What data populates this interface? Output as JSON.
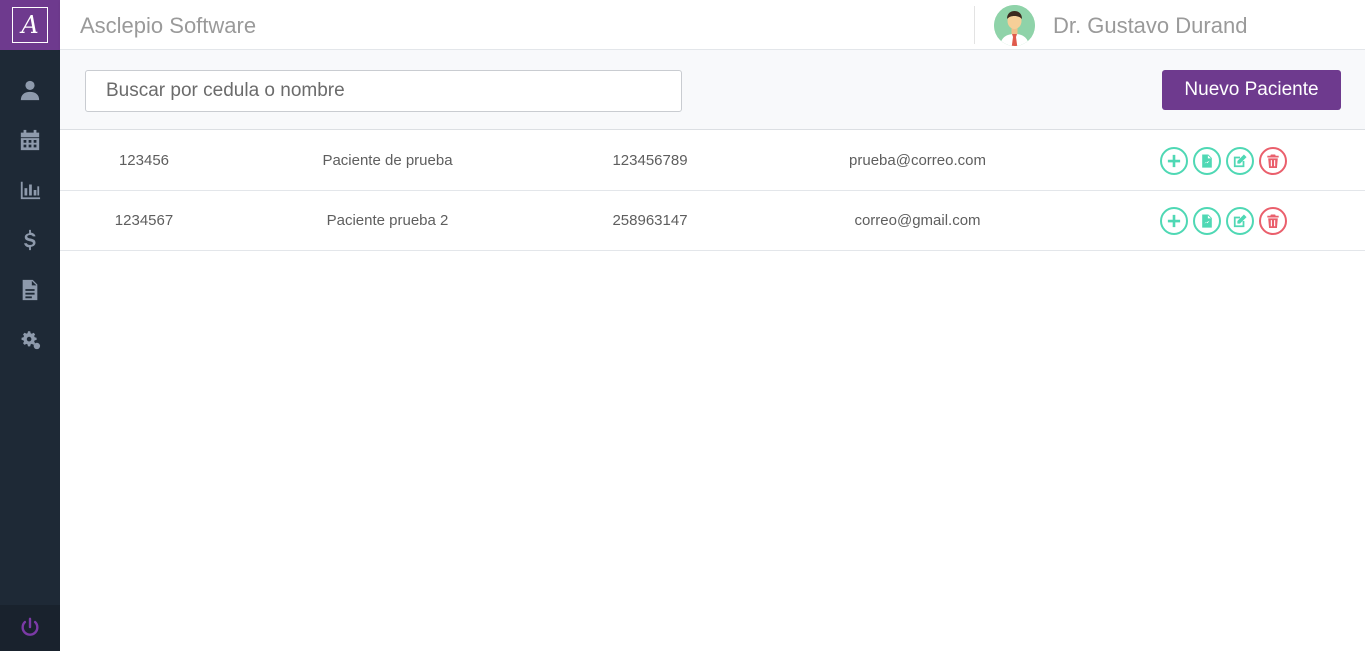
{
  "app": {
    "logo_letter": "A",
    "title": "Asclepio Software"
  },
  "user": {
    "name": "Dr. Gustavo Durand"
  },
  "sidebar": {
    "items": [
      {
        "icon": "user-icon"
      },
      {
        "icon": "calendar-icon"
      },
      {
        "icon": "bar-chart-icon"
      },
      {
        "icon": "dollar-icon"
      },
      {
        "icon": "document-icon"
      },
      {
        "icon": "gears-icon"
      }
    ],
    "logout_icon": "power-icon"
  },
  "search": {
    "placeholder": "Buscar por cedula o nombre",
    "value": ""
  },
  "toolbar": {
    "new_patient_label": "Nuevo Paciente"
  },
  "patients": [
    {
      "id": "123456",
      "name": "Paciente de prueba",
      "phone": "123456789",
      "email": "prueba@correo.com"
    },
    {
      "id": "1234567",
      "name": "Paciente prueba 2",
      "phone": "258963147",
      "email": "correo@gmail.com"
    }
  ],
  "row_actions": [
    "add-icon",
    "file-icon",
    "edit-icon",
    "trash-icon"
  ],
  "colors": {
    "brand": "#6e3a8e",
    "sidebar": "#1e2936",
    "action": "#4fd8b4",
    "danger": "#ea5f6c"
  }
}
